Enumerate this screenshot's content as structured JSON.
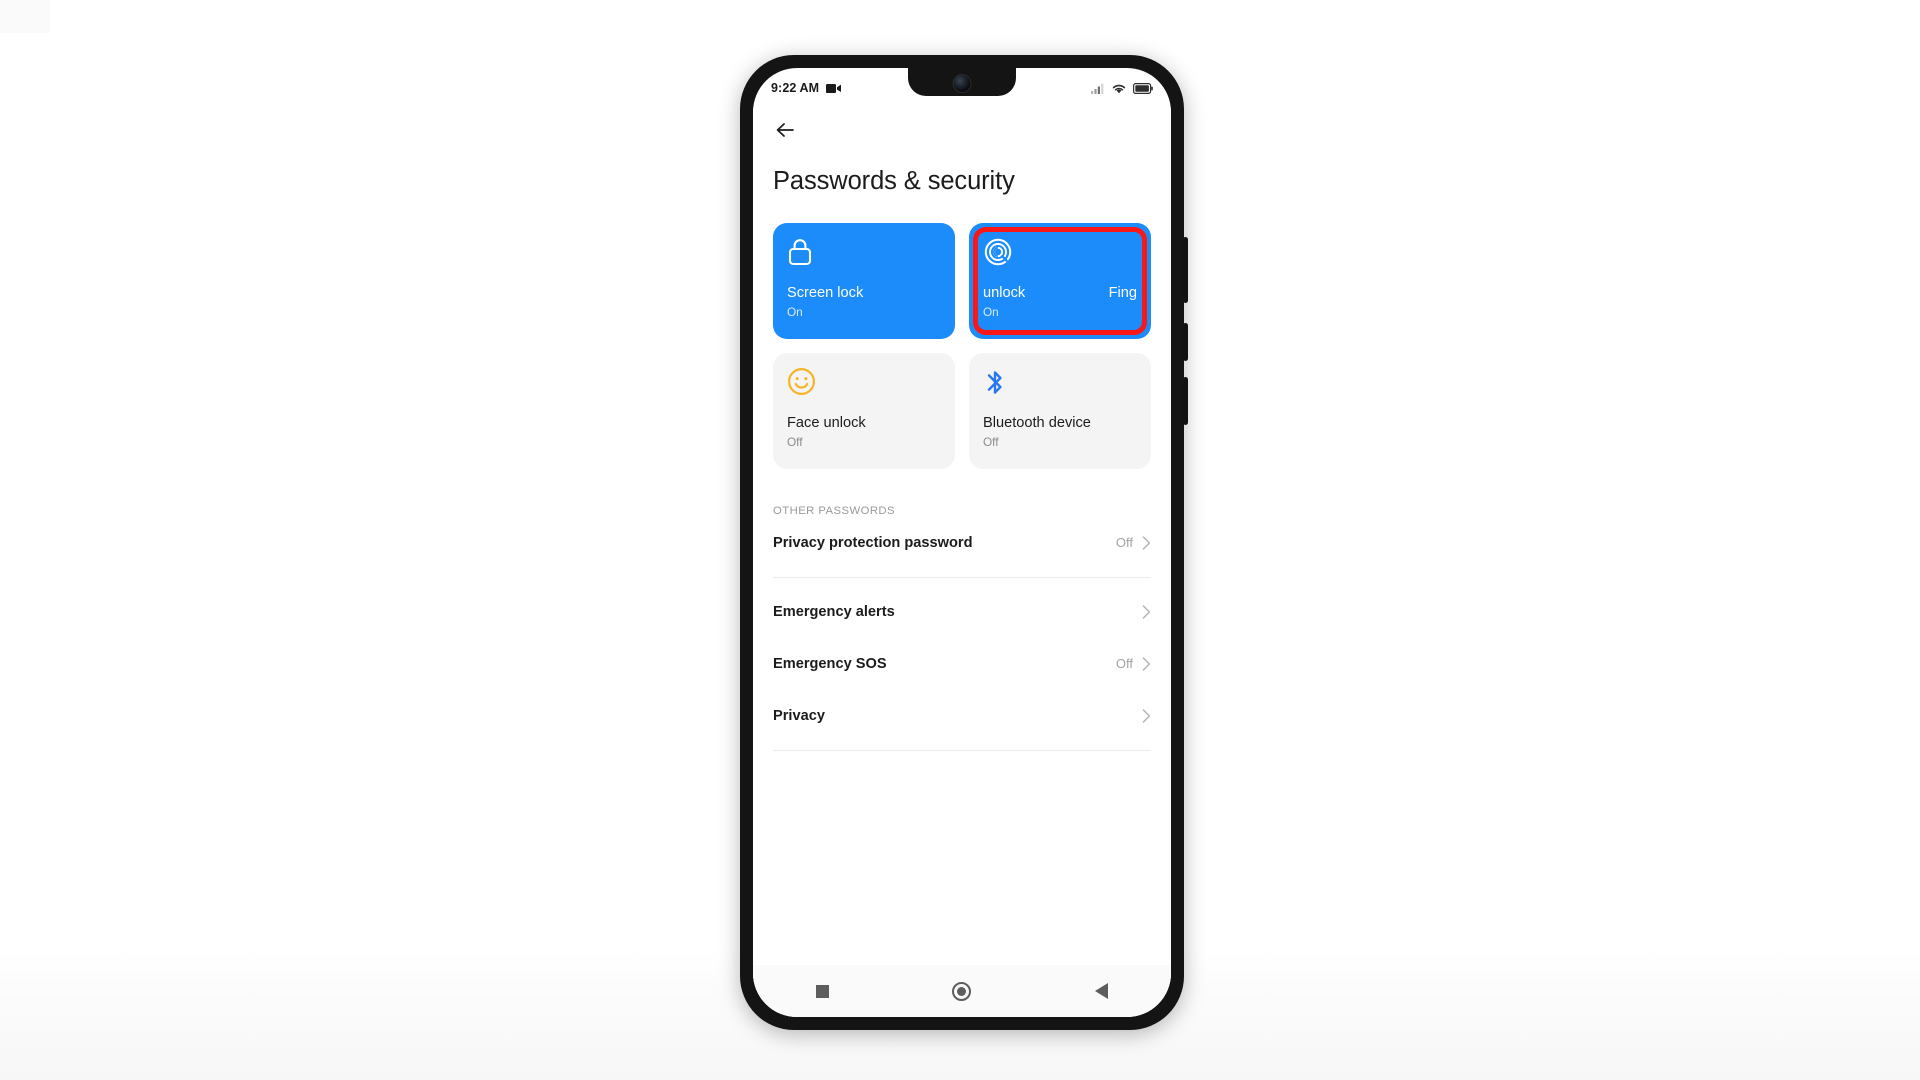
{
  "statusbar": {
    "time": "9:22 AM",
    "video_icon": "video-camera-icon",
    "signal_icon": "cellular-signal-icon",
    "wifi_icon": "wifi-icon",
    "battery_icon": "battery-icon"
  },
  "header": {
    "back_icon": "back-arrow-icon",
    "title": "Passwords & security"
  },
  "cards": [
    {
      "title": "Screen lock",
      "status": "On",
      "icon": "lock-icon",
      "state": "on"
    },
    {
      "title_left": "unlock",
      "title_right": "Fing",
      "status": "On",
      "icon": "fingerprint-icon",
      "state": "on",
      "highlighted": true
    },
    {
      "title": "Face unlock",
      "status": "Off",
      "icon": "smiley-face-icon",
      "state": "off"
    },
    {
      "title": "Bluetooth device",
      "status": "Off",
      "icon": "bluetooth-icon",
      "state": "off"
    }
  ],
  "section": {
    "label": "OTHER PASSWORDS"
  },
  "rows": [
    {
      "label": "Privacy protection password",
      "value": "Off",
      "chevron": "chevron-right-icon"
    },
    {
      "label": "Emergency alerts",
      "value": "",
      "chevron": "chevron-right-icon"
    },
    {
      "label": "Emergency SOS",
      "value": "Off",
      "chevron": "chevron-right-icon"
    },
    {
      "label": "Privacy",
      "value": "",
      "chevron": "chevron-right-icon"
    }
  ],
  "navbar": {
    "recents_icon": "square-recents-icon",
    "home_icon": "circle-home-icon",
    "back_icon": "triangle-back-icon"
  },
  "colors": {
    "accent_blue": "#1b8cf9",
    "highlight_red": "#f81818",
    "card_off_bg": "#f4f4f4",
    "face_icon_yellow": "#f6b426",
    "bluetooth_blue": "#2878f0"
  }
}
